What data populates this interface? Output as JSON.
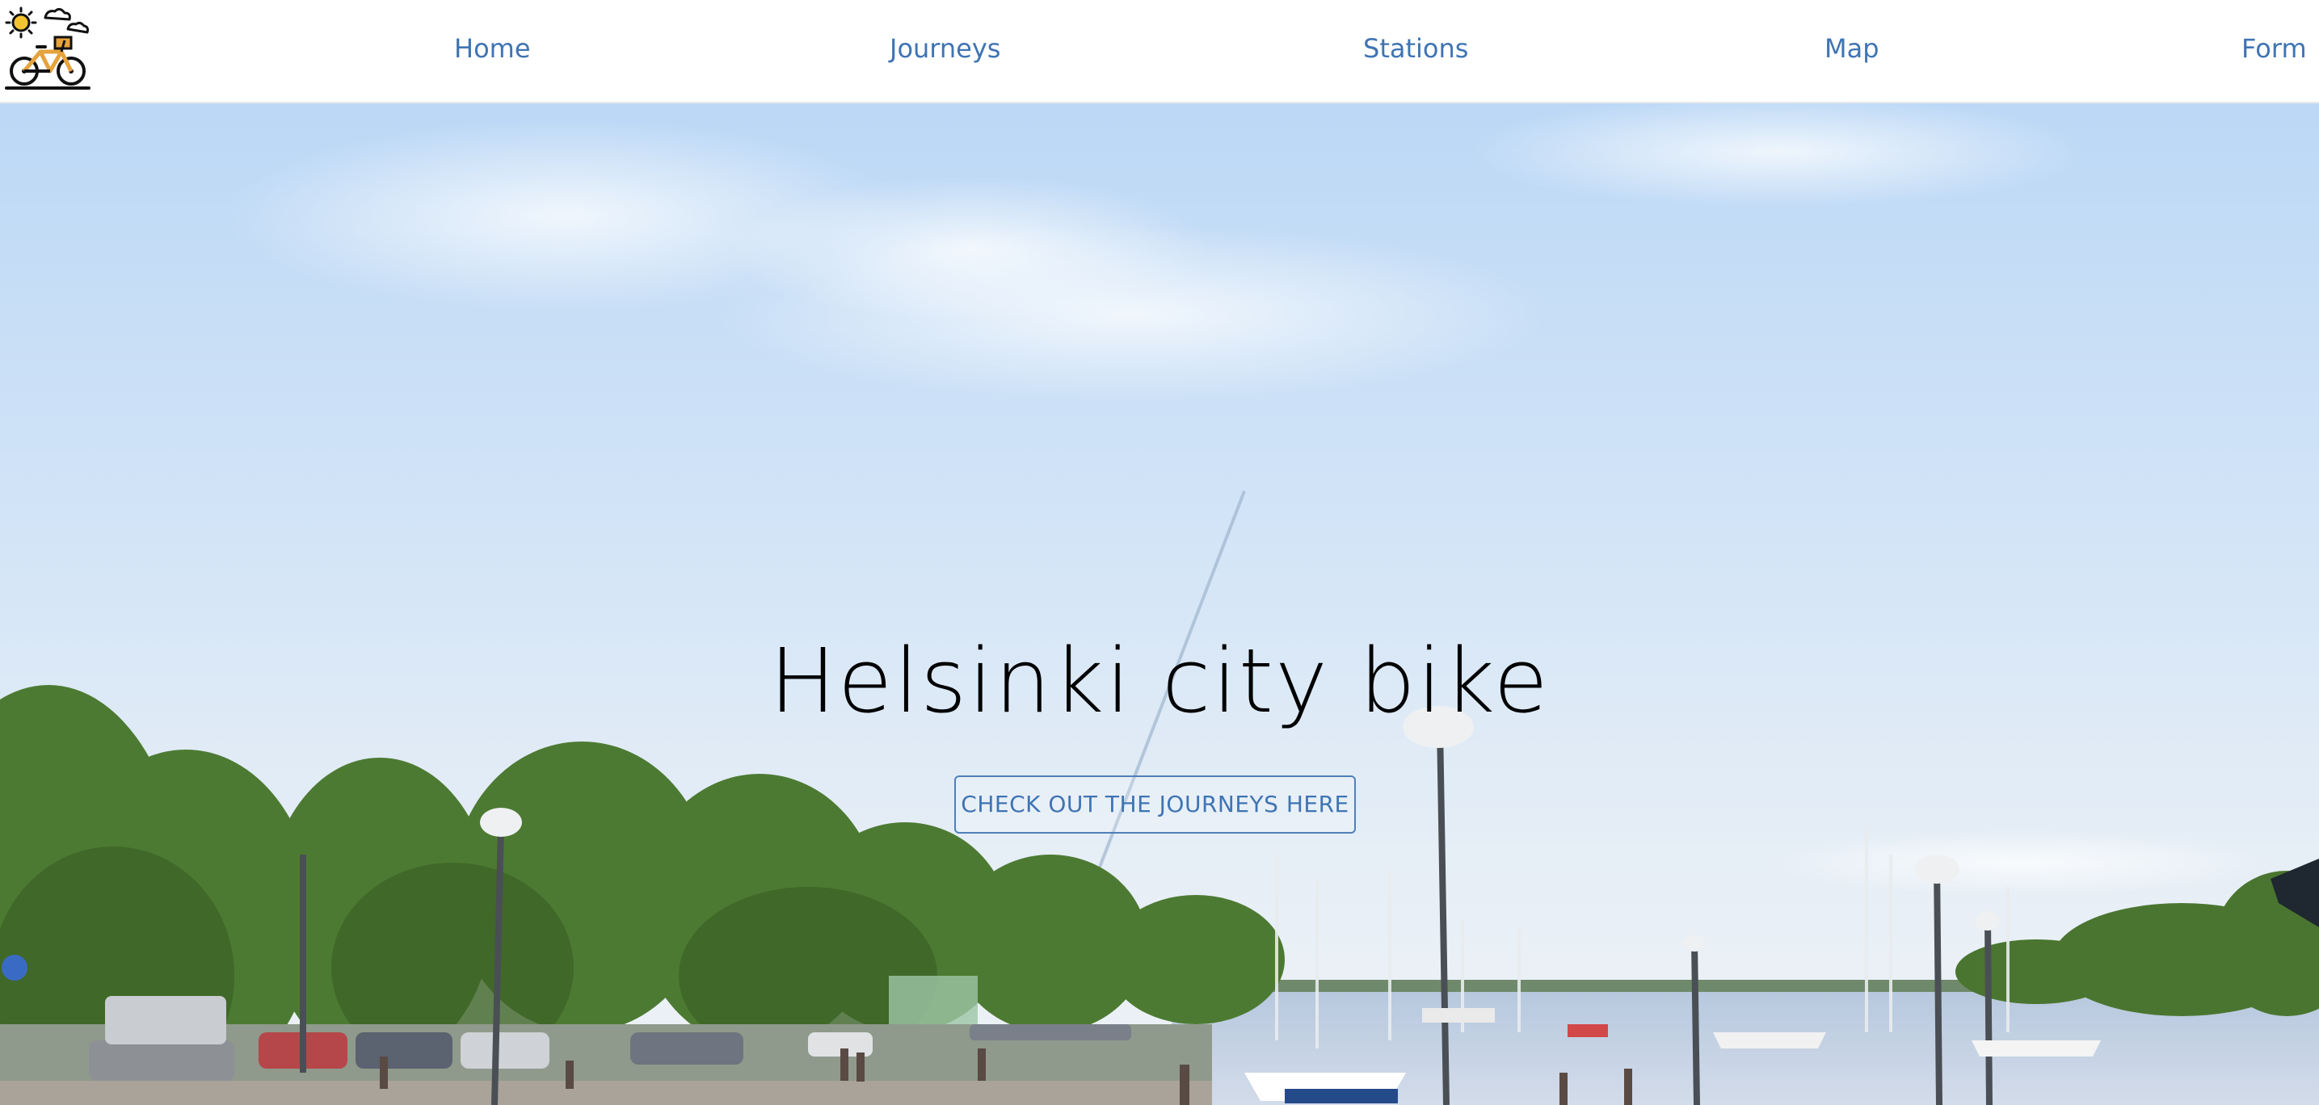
{
  "nav": {
    "logo_icon": "bike-sun-cloud-logo-icon",
    "links": [
      {
        "label": "Home"
      },
      {
        "label": "Journeys"
      },
      {
        "label": "Stations"
      },
      {
        "label": "Map"
      },
      {
        "label": "Form"
      }
    ],
    "link_color": "#3f74b4"
  },
  "hero": {
    "title": "Helsinki city bike",
    "cta_label": "CHECK OUT THE JOURNEYS HERE",
    "background_image": "helsinki-harbour-photo"
  }
}
